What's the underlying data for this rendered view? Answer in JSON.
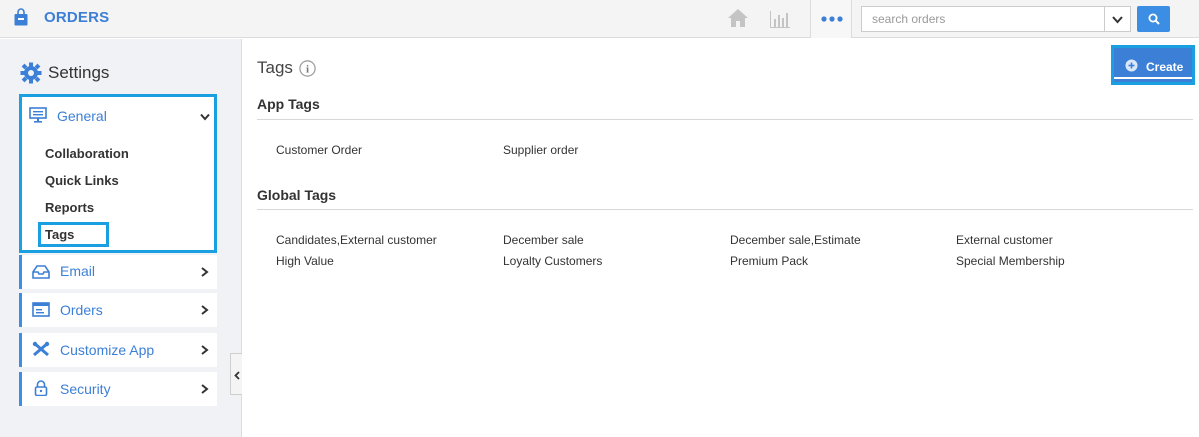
{
  "header": {
    "app_title": "ORDERS",
    "search_placeholder": "search orders",
    "icons": [
      "bag-icon",
      "home-icon",
      "chart-icon",
      "more-icon",
      "chevron-down-icon",
      "search-icon"
    ],
    "accent_color": "#3c8de4"
  },
  "sidebar": {
    "title": "Settings",
    "general": {
      "label": "General",
      "expanded": true,
      "subitems": [
        {
          "label": "Collaboration",
          "active": false
        },
        {
          "label": "Quick Links",
          "active": false
        },
        {
          "label": "Reports",
          "active": false
        },
        {
          "label": "Tags",
          "active": true
        }
      ]
    },
    "items": [
      {
        "label": "Email",
        "icon": "inbox-icon"
      },
      {
        "label": "Orders",
        "icon": "orders-icon"
      },
      {
        "label": "Customize App",
        "icon": "tools-icon"
      },
      {
        "label": "Security",
        "icon": "lock-icon"
      }
    ]
  },
  "main": {
    "title": "Tags",
    "create_label": "Create",
    "app_tags": {
      "title": "App Tags",
      "tags": [
        "Customer Order",
        "Supplier order"
      ]
    },
    "global_tags": {
      "title": "Global Tags",
      "tags": [
        "Candidates,External customer",
        "December sale",
        "December sale,Estimate",
        "External customer",
        "High Value",
        "Loyalty Customers",
        "Premium Pack",
        "Special Membership"
      ]
    }
  }
}
